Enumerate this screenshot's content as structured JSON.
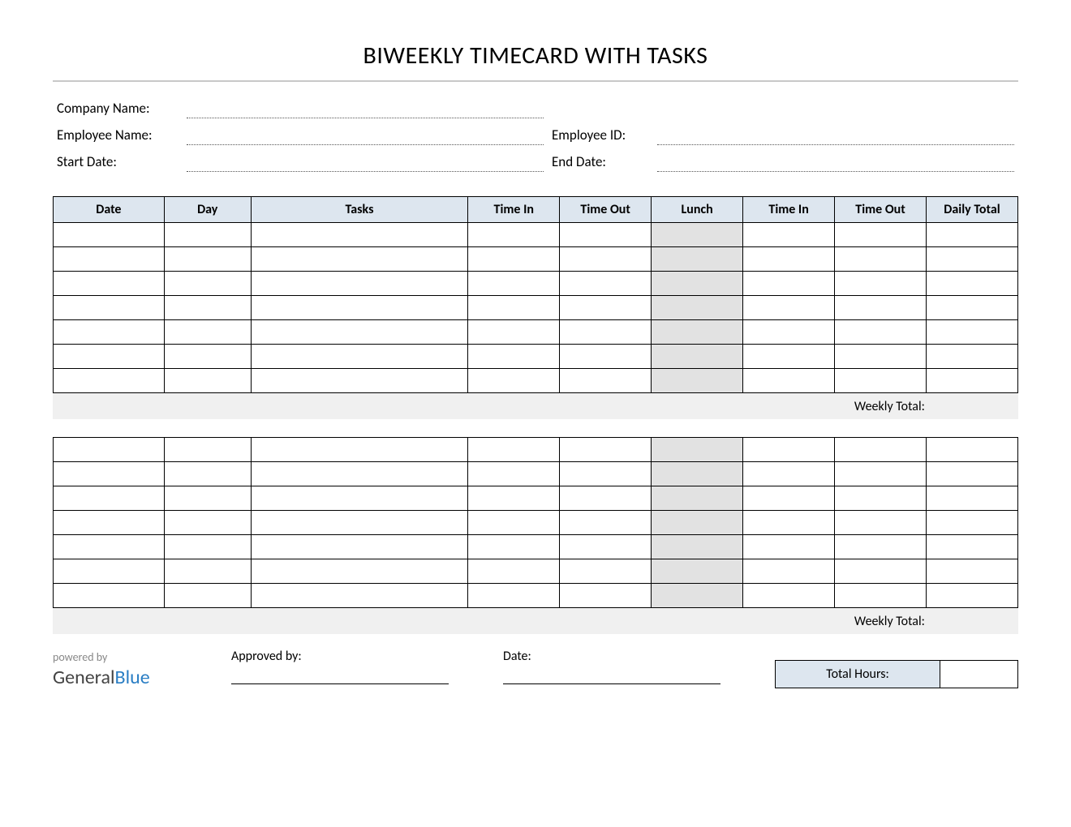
{
  "title": "BIWEEKLY TIMECARD WITH TASKS",
  "info": {
    "company_label": "Company Name:",
    "employee_label": "Employee Name:",
    "employee_id_label": "Employee ID:",
    "start_date_label": "Start Date:",
    "end_date_label": "End Date:"
  },
  "columns": {
    "date": "Date",
    "day": "Day",
    "tasks": "Tasks",
    "time_in": "Time In",
    "time_out": "Time Out",
    "lunch": "Lunch",
    "time_in2": "Time In",
    "time_out2": "Time Out",
    "daily_total": "Daily Total"
  },
  "weekly_total_label": "Weekly Total:",
  "footer": {
    "powered_by": "powered by",
    "logo_general": "General",
    "logo_blue": "Blue",
    "approved_by": "Approved by:",
    "date": "Date:",
    "total_hours": "Total Hours:"
  }
}
